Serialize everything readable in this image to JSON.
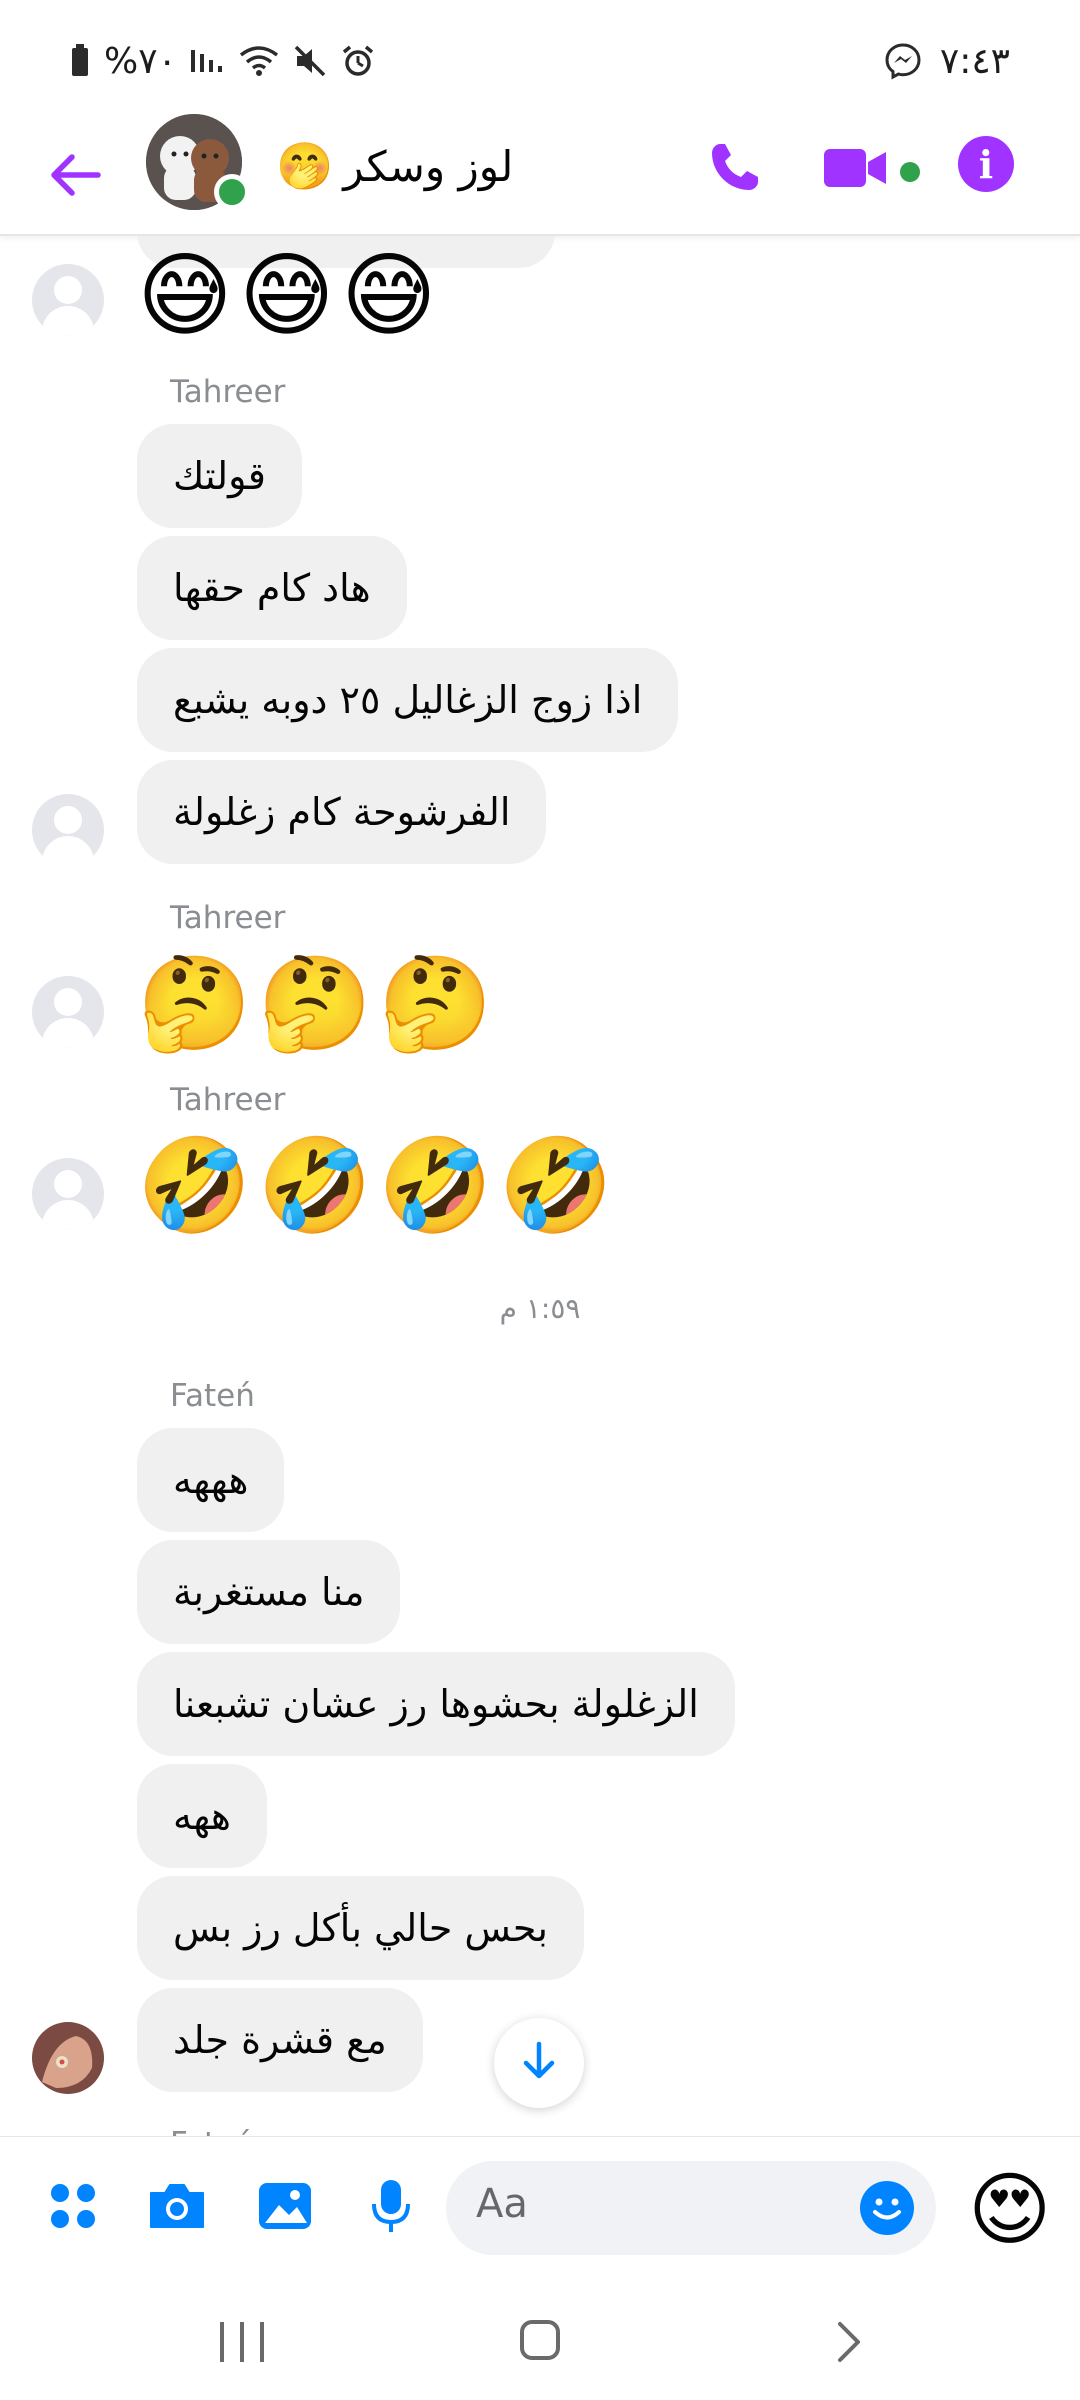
{
  "status_bar": {
    "battery": "%٧٠",
    "time": "٧:٤٣"
  },
  "header": {
    "title": "لوز وسكر",
    "title_emoji": "🤭"
  },
  "messages": {
    "top_emojis": [
      "😅",
      "😅",
      "😅"
    ],
    "group1": {
      "sender": "Tahreer",
      "bubbles": [
        "قولتك",
        "هاد كام حقها",
        "اذا زوج الزغاليل ٢٥ دوبه يشبع",
        "الفرشوحة كام زغلولة"
      ]
    },
    "group2": {
      "sender": "Tahreer",
      "emojis": [
        "🤔",
        "🤔",
        "🤔"
      ]
    },
    "group3": {
      "sender": "Tahreer",
      "emojis": [
        "🤣",
        "🤣",
        "🤣",
        "🤣"
      ]
    },
    "timestamp": "١:٥٩ م",
    "group4": {
      "sender": "Fateń",
      "bubbles": [
        "هههه",
        "منا مستغربة",
        "الزغلولة بحشوها رز عشان تشبعنا",
        "ههه",
        "بحس حالي بأكل رز بس",
        "مع قشرة جلد"
      ]
    },
    "cut_sender": "Fateń"
  },
  "composer": {
    "placeholder": "Aa",
    "quick_reaction": "😍"
  },
  "colors": {
    "accent": "#a033ff",
    "online": "#31a24c",
    "bubble": "#f0f0f0",
    "blue": "#0084ff"
  }
}
